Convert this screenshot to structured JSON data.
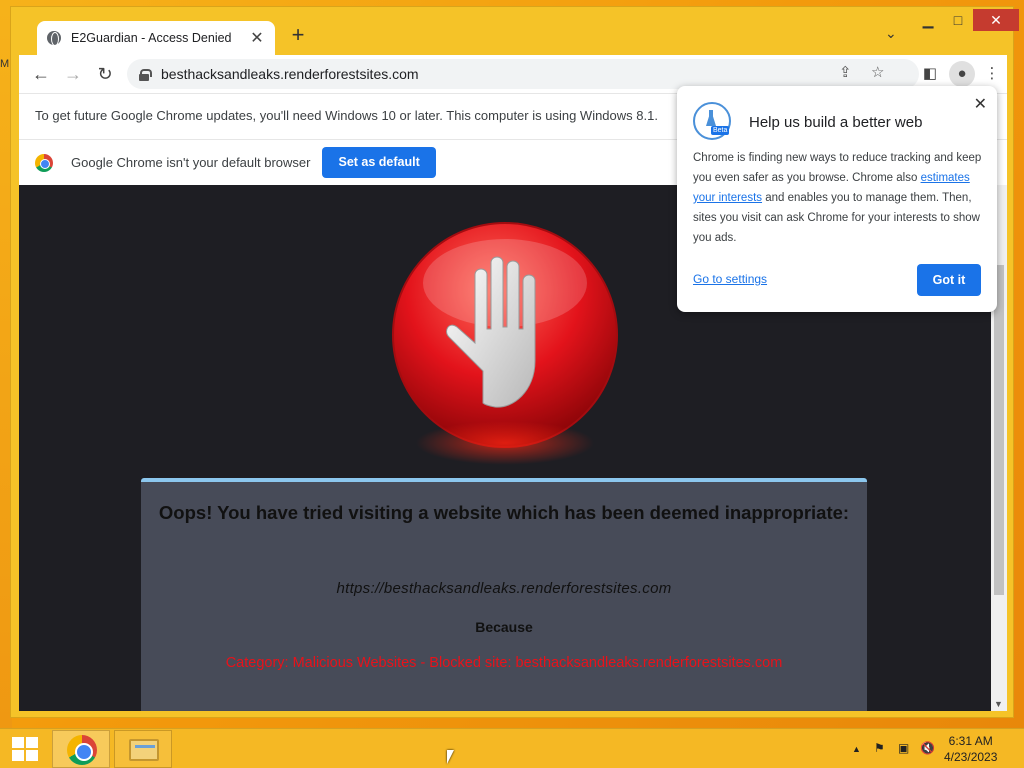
{
  "desktop": {
    "left_edge_text": "M"
  },
  "window": {
    "min": "▁",
    "max": "□",
    "close": "✕"
  },
  "tab": {
    "title": "E2Guardian - Access Denied",
    "close": "✕"
  },
  "newtab": "+",
  "tab_search": "⌄",
  "toolbar": {
    "back": "←",
    "forward": "→",
    "reload": "↻",
    "url": "besthacksandleaks.renderforestsites.com",
    "share": "⇪",
    "star": "☆",
    "sidepanel": "◧",
    "profile": "●",
    "menu": "⋮"
  },
  "infobar_update": {
    "text": "To get future Google Chrome updates, you'll need Windows 10 or later. This computer is using Windows 8.1."
  },
  "infobar_default": {
    "text": "Google Chrome isn't your default browser",
    "button": "Set as default"
  },
  "blocked_page": {
    "heading": "Oops! You have tried visiting a website which has been deemed inappropriate:",
    "url": "https://besthacksandleaks.renderforestsites.com",
    "because": "Because",
    "reason": "Category: Malicious Websites - Blocked site: besthacksandleaks.renderforestsites.com",
    "reason_color": "#e8121a"
  },
  "popup": {
    "badge": "Beta",
    "title": "Help us build a better web",
    "body_1": "Chrome is finding new ways to reduce tracking and keep you even safer as you browse. Chrome also ",
    "body_link": "estimates your interests",
    "body_2": " and enables you to manage them. Then, sites you visit can ask Chrome for your interests to show you ads.",
    "settings_link": "Go to settings",
    "button": "Got it",
    "close": "✕"
  },
  "scrollbar": {
    "arrow": "▼"
  },
  "taskbar": {
    "apps": [
      "chrome-icon",
      "file-explorer-icon"
    ],
    "tray": {
      "chevron": "▲",
      "flag": "⚑",
      "network": "▣",
      "volume": "🔇"
    },
    "time": "6:31 AM",
    "date": "4/23/2023"
  },
  "colors": {
    "accent": "#1a73e8",
    "page_bg": "#1e1e23",
    "panel_bg": "#474b58",
    "taskbar": "#f5b824"
  }
}
